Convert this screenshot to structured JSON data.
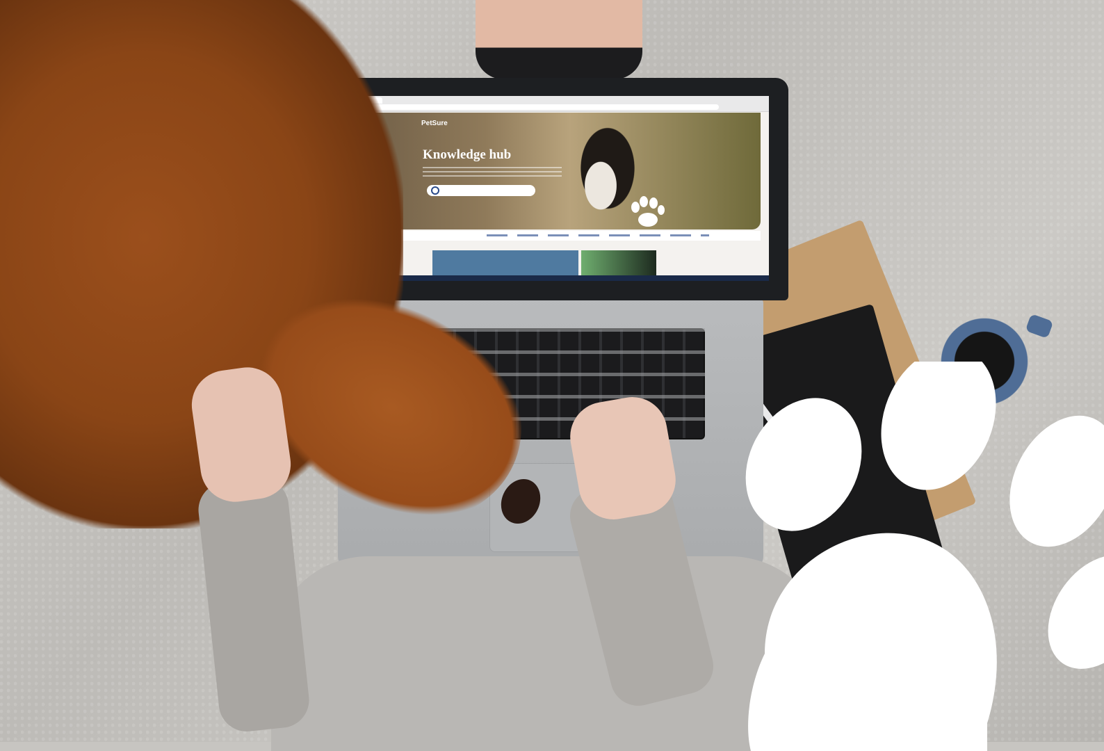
{
  "photo": {
    "description_key": "dog-and-laptop-photo"
  },
  "screen": {
    "brand": "PetSure",
    "hero_title": "Knowledge hub"
  },
  "colors": {
    "paw": "#ffffff",
    "dog_fur": "#9b4f1c",
    "blanket": "#c7c5c1"
  },
  "icons": {
    "paw": "paw-icon",
    "search": "search-icon"
  }
}
